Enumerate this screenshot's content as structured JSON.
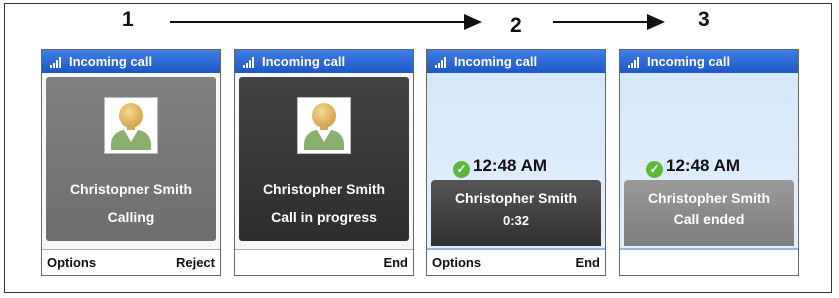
{
  "steps": [
    "1",
    "2",
    "3"
  ],
  "phones": [
    {
      "title": "Incoming call",
      "name": "Christopner Smith",
      "status": "Calling",
      "left_key": "Options",
      "right_key": "Reject"
    },
    {
      "title": "Incoming call",
      "name": "Christopher Smith",
      "status": "Call in progress",
      "left_key": "",
      "right_key": "End"
    },
    {
      "title": "Incoming call",
      "time": "12:48 AM",
      "name": "Christopher Smith",
      "status": "0:32",
      "left_key": "Options",
      "right_key": "End"
    },
    {
      "title": "Incoming call",
      "time": "12:48 AM",
      "name": "Christopher Smith",
      "status": "Call ended",
      "left_key": "",
      "right_key": ""
    }
  ],
  "colors": {
    "titlebar": "#2a66d4",
    "check": "#5bb83a",
    "screen_light": "#dce9fa"
  },
  "icons": [
    "signal-icon",
    "contact-avatar-icon",
    "check-circle-icon",
    "arrow-right-icon"
  ]
}
